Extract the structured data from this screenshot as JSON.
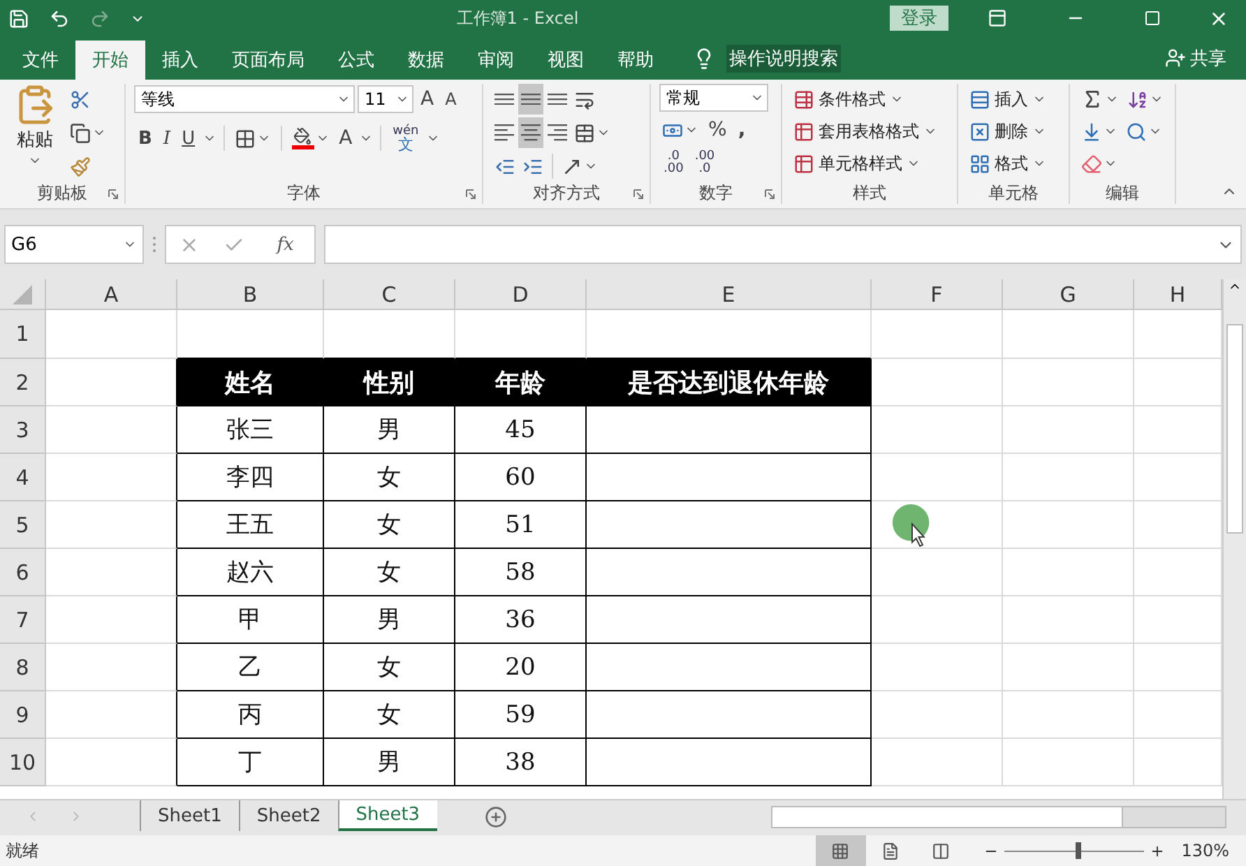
{
  "window": {
    "title": "工作簿1  -  Excel",
    "login": "登录"
  },
  "menu_tabs": [
    {
      "label": "文件",
      "selected": false
    },
    {
      "label": "开始",
      "selected": true
    },
    {
      "label": "插入",
      "selected": false
    },
    {
      "label": "页面布局",
      "selected": false
    },
    {
      "label": "公式",
      "selected": false
    },
    {
      "label": "数据",
      "selected": false
    },
    {
      "label": "审阅",
      "selected": false
    },
    {
      "label": "视图",
      "selected": false
    },
    {
      "label": "帮助",
      "selected": false
    }
  ],
  "tell_me": "操作说明搜索",
  "share": "共享",
  "ribbon": {
    "clipboard": {
      "label": "剪贴板",
      "paste": "粘贴"
    },
    "font": {
      "label": "字体",
      "font_name": "等线",
      "font_size": "11",
      "grow": "A",
      "shrink": "A",
      "bold": "B",
      "italic": "I",
      "underline": "U",
      "font_color": "A",
      "phonetic_top": "wén",
      "phonetic_bottom": "文"
    },
    "alignment": {
      "label": "对齐方式",
      "buttons": [
        {
          "kind": "top",
          "selected": false
        },
        {
          "kind": "middle",
          "selected": true
        },
        {
          "kind": "bottom",
          "selected": false
        },
        {
          "kind": "left",
          "selected": false
        },
        {
          "kind": "center",
          "selected": true
        },
        {
          "kind": "right",
          "selected": false
        }
      ]
    },
    "number": {
      "label": "数字",
      "format": "常规",
      "percent": "%",
      "comma": ",",
      "decimals": [
        {
          "top": ".0",
          "bottom": ".00"
        },
        {
          "top": ".00",
          "bottom": ".0"
        }
      ]
    },
    "styles": {
      "label": "样式",
      "items": [
        "条件格式",
        "套用表格格式",
        "单元格样式"
      ]
    },
    "cells": {
      "label": "单元格",
      "items": [
        "插入",
        "删除",
        "格式"
      ]
    },
    "editing": {
      "label": "编辑"
    }
  },
  "formula_bar": {
    "name_box": "G6",
    "fx": "fx"
  },
  "sheet": {
    "columns": [
      "A",
      "B",
      "C",
      "D",
      "E",
      "F",
      "G",
      "H"
    ],
    "rows": [
      "1",
      "2",
      "3",
      "4",
      "5",
      "6",
      "7",
      "8",
      "9",
      "10"
    ],
    "table": {
      "header": [
        "姓名",
        "性别",
        "年龄",
        "是否达到退休年龄"
      ],
      "records": [
        [
          "张三",
          "男",
          "45"
        ],
        [
          "李四",
          "女",
          "60"
        ],
        [
          "王五",
          "女",
          "51"
        ],
        [
          "赵六",
          "女",
          "58"
        ],
        [
          "甲",
          "男",
          "36"
        ],
        [
          "乙",
          "女",
          "20"
        ],
        [
          "丙",
          "女",
          "59"
        ],
        [
          "丁",
          "男",
          "38"
        ]
      ]
    }
  },
  "sheet_tabs": [
    {
      "label": "Sheet1",
      "selected": false
    },
    {
      "label": "Sheet2",
      "selected": false
    },
    {
      "label": "Sheet3",
      "selected": true
    }
  ],
  "status_bar": {
    "text": "就绪",
    "views": [
      {
        "kind": "normal",
        "selected": true
      },
      {
        "kind": "page-layout",
        "selected": false
      },
      {
        "kind": "page-break",
        "selected": false
      }
    ],
    "zoom_slider": {
      "level": 0.55
    },
    "zoom": "130%"
  }
}
